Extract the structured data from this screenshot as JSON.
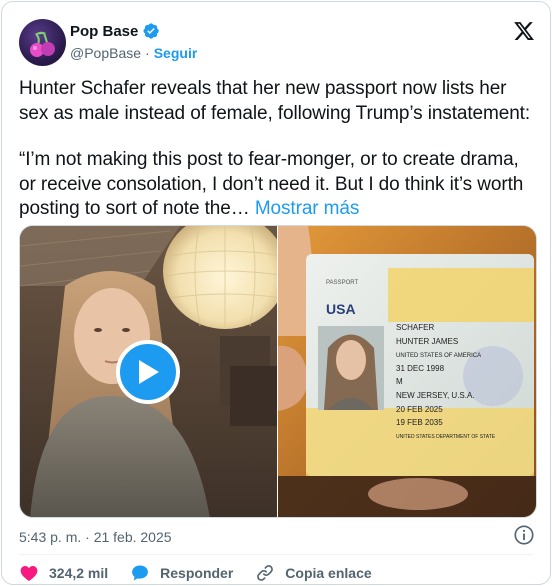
{
  "author": {
    "name": "Pop Base",
    "handle": "@PopBase",
    "separator": "·",
    "follow_label": "Seguir"
  },
  "tweet": {
    "paragraph1": "Hunter Schafer reveals that her new passport now lists her sex as male instead of female, following Trump’s instatement:",
    "paragraph2": "“I’m not making this post to fear-monger, or to create drama, or receive consolation, I don’t need it. But I do think it’s worth posting to sort of note the…",
    "show_more": "Mostrar más"
  },
  "media": {
    "passport": {
      "country": "USA",
      "passport_label": "PASSPORT",
      "surname": "SCHAFER",
      "given_names": "HUNTER JAMES",
      "nationality": "UNITED STATES OF AMERICA",
      "dob": "31 DEC 1998",
      "sex": "M",
      "place_of_birth": "NEW JERSEY, U.S.A.",
      "issue_date": "20 FEB 2025",
      "expiry_date": "19 FEB 2035",
      "authority": "UNITED STATES DEPARTMENT OF STATE"
    }
  },
  "meta": {
    "timestamp": "5:43 p. m. · 21 feb. 2025"
  },
  "actions": {
    "likes": "324,2 mil",
    "reply_label": "Responder",
    "copy_link_label": "Copia enlace"
  },
  "colors": {
    "accent": "#1d9bf0",
    "like": "#f91880",
    "muted": "#536471"
  }
}
